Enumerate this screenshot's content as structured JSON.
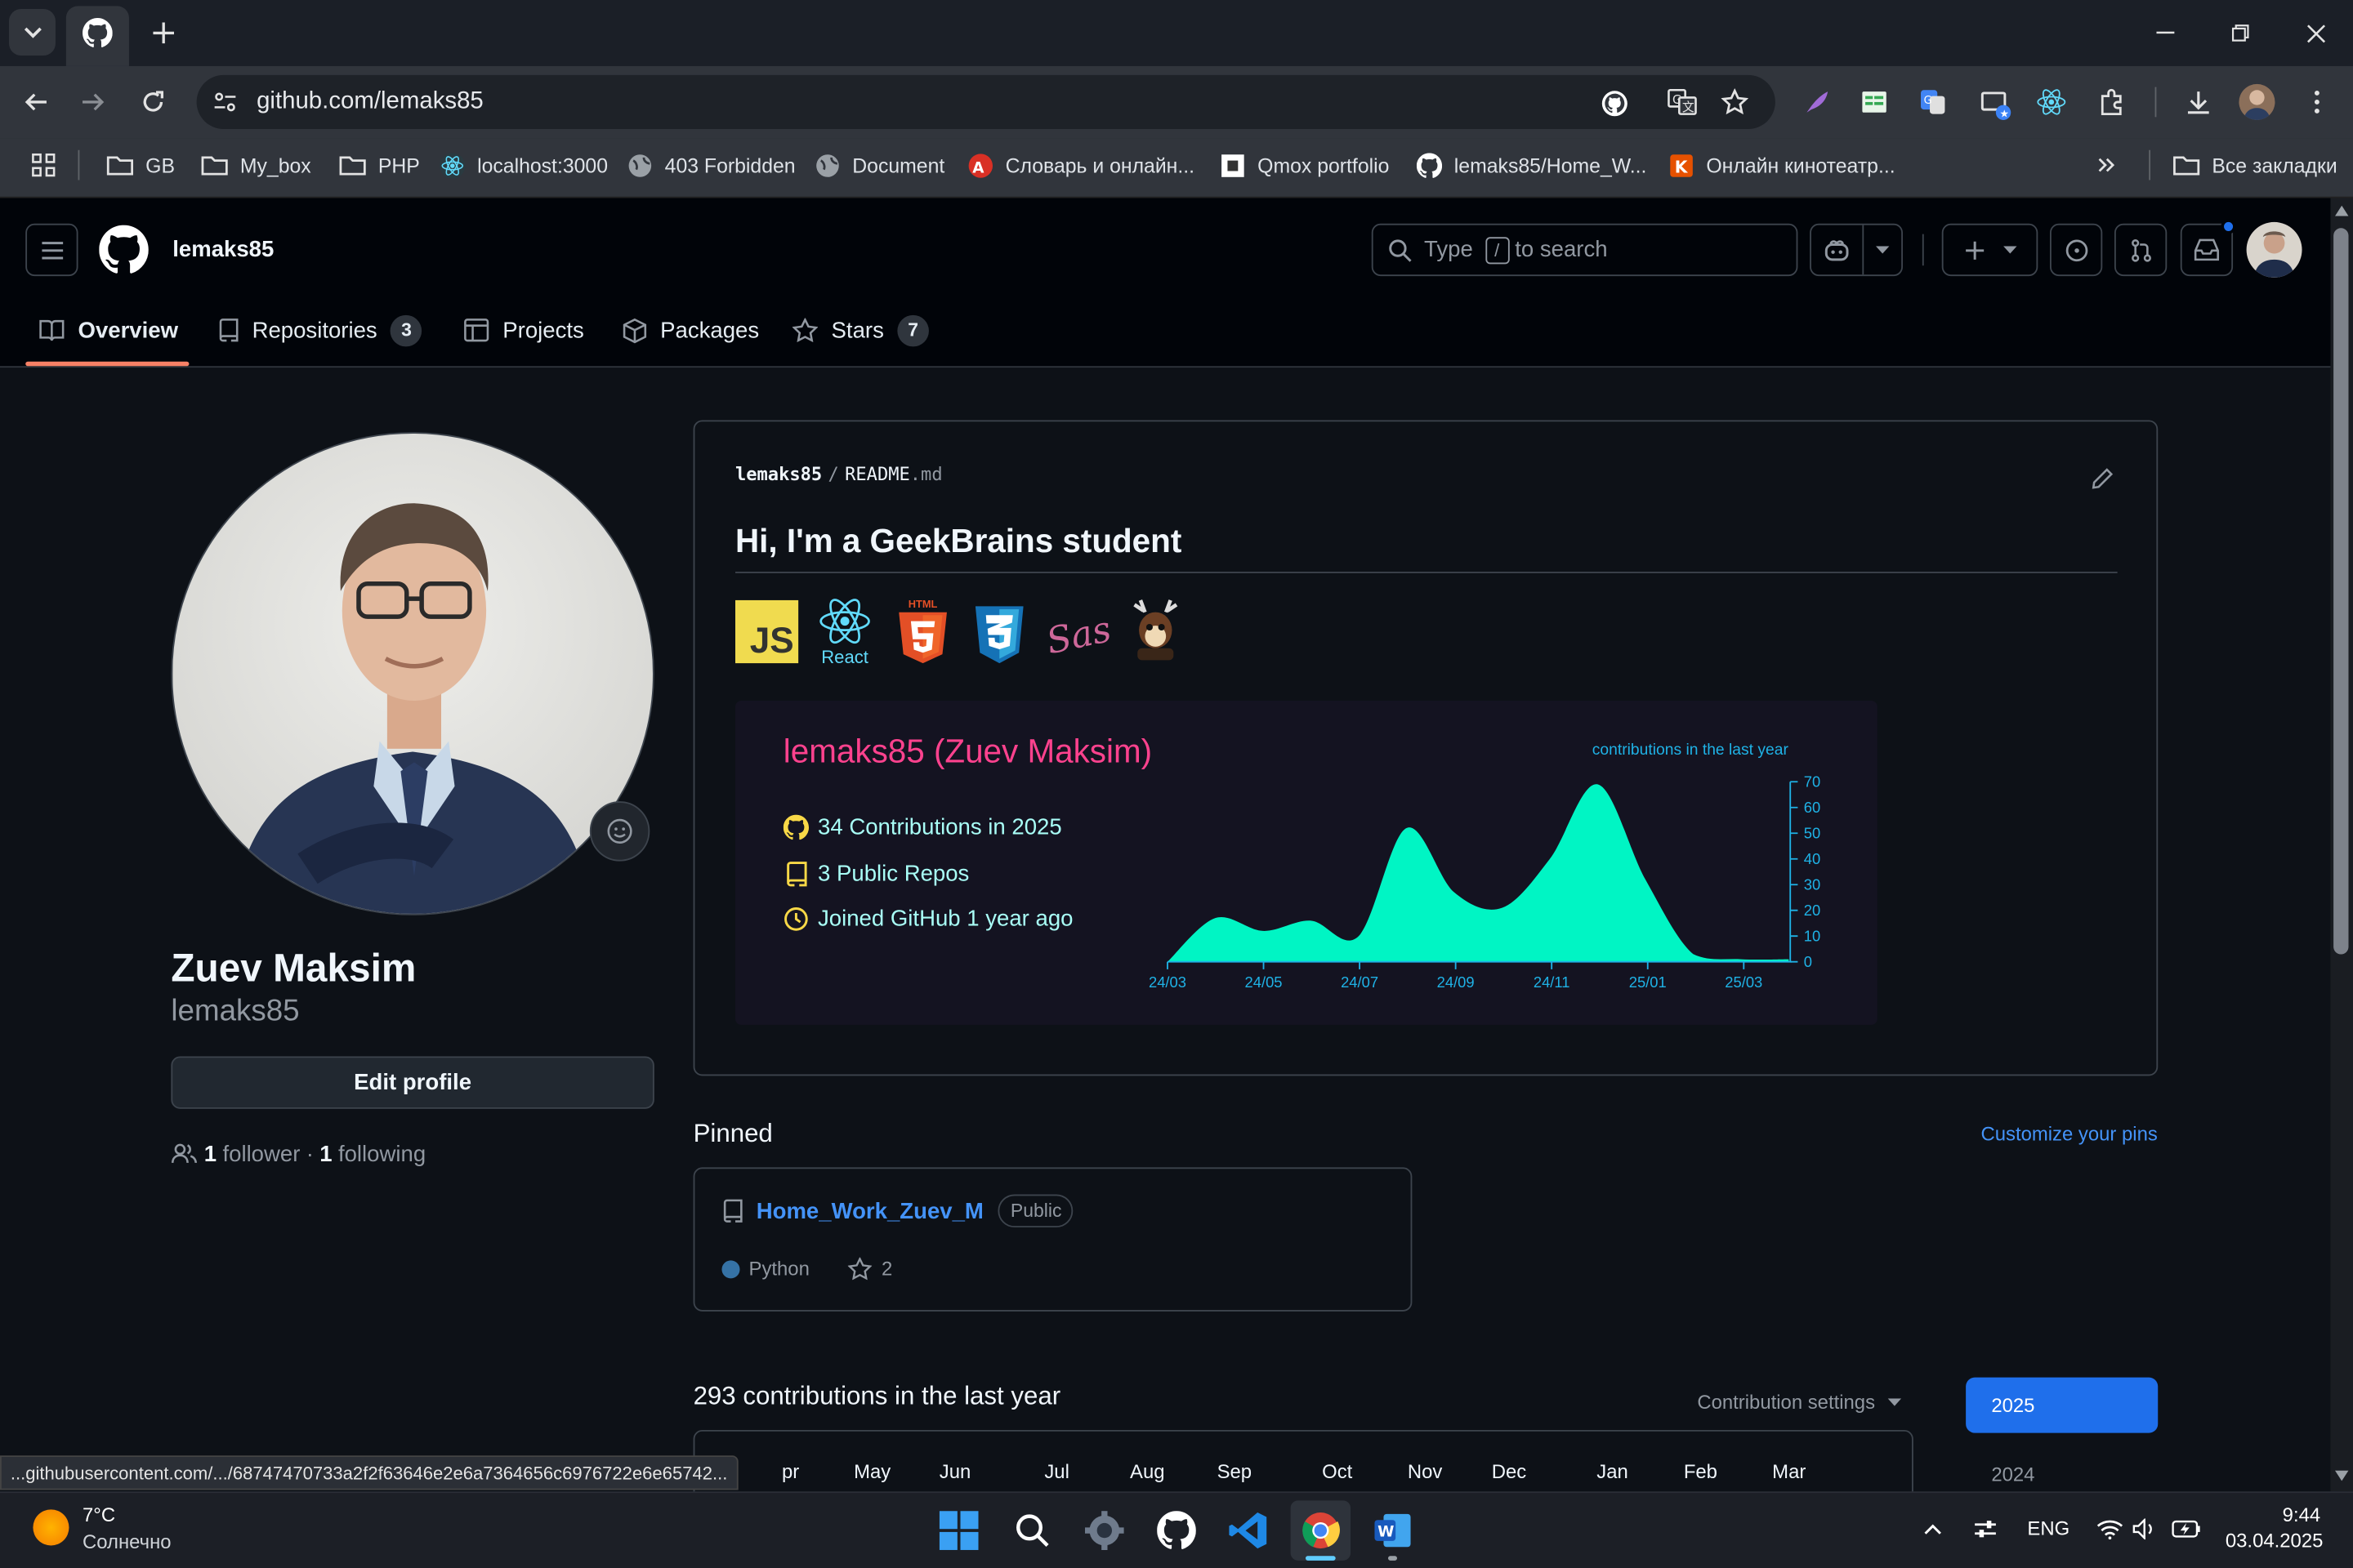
{
  "browser": {
    "url": "github.com/lemaks85",
    "bookmarks": [
      "GB",
      "My_box",
      "PHP",
      "localhost:3000",
      "403 Forbidden",
      "Document",
      "Словарь и онлайн...",
      "Qmox portfolio",
      "lemaks85/Home_W...",
      "Онлайн кинотеатр..."
    ],
    "all_bookmarks": "Все закладки",
    "status_url": "...githubusercontent.com/.../68747470733a2f2f63646e2e6a7364656c6976722e6e65742..."
  },
  "header": {
    "username": "lemaks85",
    "search_placeholder_pre": "Type",
    "search_key": "/",
    "search_placeholder_post": "to search"
  },
  "nav": {
    "overview": "Overview",
    "repositories": "Repositories",
    "repositories_count": "3",
    "projects": "Projects",
    "packages": "Packages",
    "stars": "Stars",
    "stars_count": "7"
  },
  "profile": {
    "name": "Zuev Maksim",
    "login": "lemaks85",
    "edit_button": "Edit profile",
    "followers_count": "1",
    "followers_label": "follower",
    "separator": "·",
    "following_count": "1",
    "following_label": "following"
  },
  "readme": {
    "owner": "lemaks85",
    "slash": "/",
    "file": "README",
    "ext": ".md",
    "heading": "Hi, I'm a GeekBrains student",
    "badges": [
      "JS",
      "React",
      "HTML",
      "Sass"
    ],
    "stats": {
      "title": "lemaks85 (Zuev Maksim)",
      "contributions": "34 Contributions in 2025",
      "repos": "3 Public Repos",
      "joined": "Joined GitHub 1 year ago",
      "chart_label": "contributions in the last year"
    }
  },
  "chart_data": {
    "type": "area",
    "title": "contributions in the last year",
    "x_ticks": [
      "24/03",
      "24/05",
      "24/07",
      "24/09",
      "24/11",
      "25/01",
      "25/03"
    ],
    "y_ticks": [
      0,
      10,
      20,
      30,
      40,
      50,
      60,
      70
    ],
    "ylim": [
      0,
      70
    ],
    "grid": false,
    "x": [
      "24/03",
      "24/04",
      "24/05",
      "24/06",
      "24/07",
      "24/08",
      "24/09",
      "24/10",
      "24/11",
      "24/12",
      "25/01",
      "25/02",
      "25/03",
      "25/04"
    ],
    "values": [
      0,
      17,
      12,
      16,
      10,
      52,
      27,
      21,
      40,
      69,
      32,
      3,
      1,
      1
    ],
    "colors": {
      "fill": "#00f5c4",
      "axis": "#1fb2e6"
    }
  },
  "pinned": {
    "title": "Pinned",
    "customize": "Customize your pins",
    "repo_name": "Home_Work_Zuev_M",
    "visibility": "Public",
    "language": "Python",
    "language_color": "#3572A5",
    "stars": "2"
  },
  "contrib": {
    "title": "293 contributions in the last year",
    "settings": "Contribution settings",
    "months": [
      "pr",
      "May",
      "Jun",
      "Jul",
      "Aug",
      "Sep",
      "Oct",
      "Nov",
      "Dec",
      "Jan",
      "Feb",
      "Mar"
    ],
    "years": [
      "2025",
      "2024"
    ]
  },
  "taskbar": {
    "temperature": "7°C",
    "weather": "Солнечно",
    "lang": "ENG",
    "time": "9:44",
    "date": "03.04.2025"
  }
}
